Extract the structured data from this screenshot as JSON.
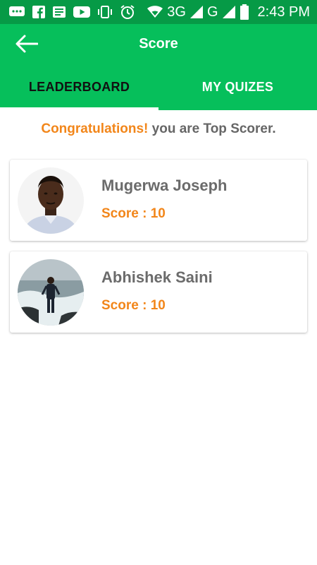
{
  "status_bar": {
    "network": "3G",
    "network2": "G",
    "time": "2:43 PM",
    "icons": [
      "chat-icon",
      "facebook-icon",
      "news-icon",
      "youtube-icon",
      "vibrate-icon",
      "alarm-icon",
      "wifi-icon",
      "signal-icon",
      "signal-icon",
      "battery-icon"
    ]
  },
  "app_bar": {
    "title": "Score",
    "back_icon": "arrow-left-icon"
  },
  "tabs": [
    {
      "label": "LEADERBOARD",
      "selected": true
    },
    {
      "label": "MY QUIZES",
      "selected": false
    }
  ],
  "banner": {
    "highlight": "Congratulations!",
    "text": "you are Top Scorer."
  },
  "leaderboard": [
    {
      "name": "Mugerwa Joseph",
      "score": "Score : 10"
    },
    {
      "name": "Abhishek Saini",
      "score": "Score : 10"
    }
  ],
  "colors": {
    "status_bar": "#069a46",
    "app_bar": "#06bf5b",
    "accent_orange": "#f2861a",
    "name_text": "#6b6b6b"
  }
}
